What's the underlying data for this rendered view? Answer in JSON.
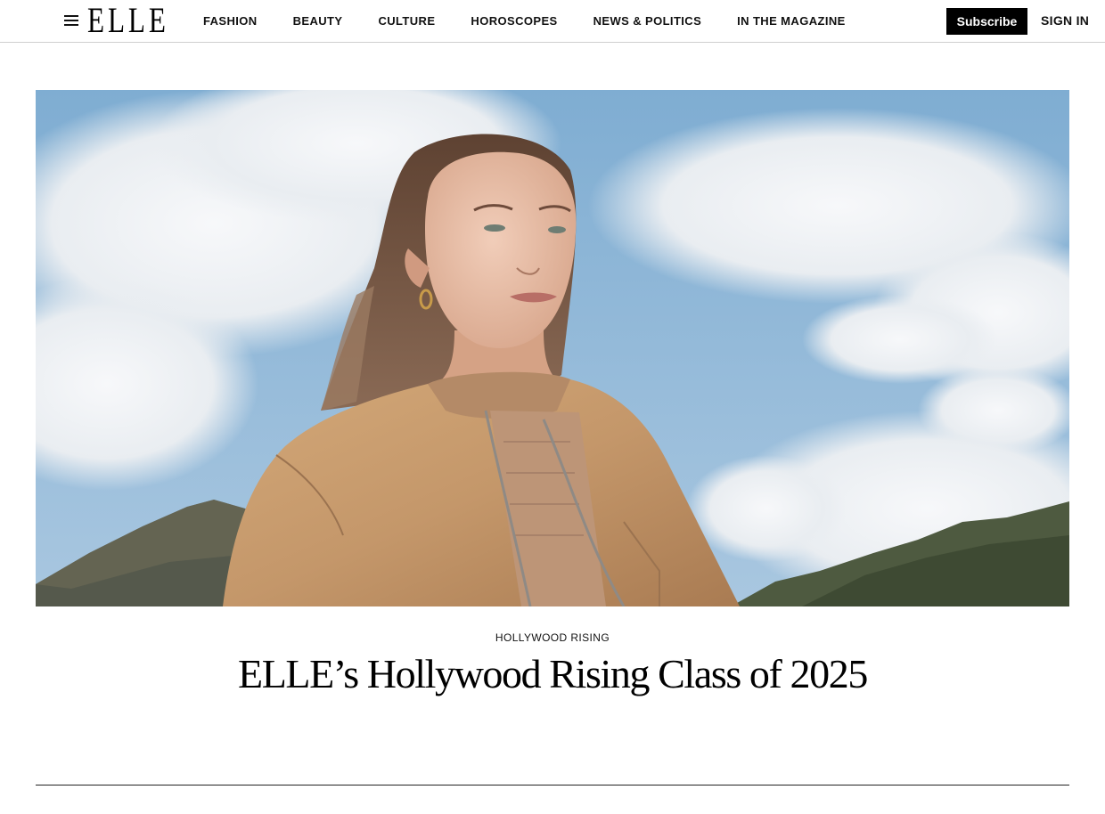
{
  "header": {
    "logo": "ELLE",
    "nav": [
      "FASHION",
      "BEAUTY",
      "CULTURE",
      "HOROSCOPES",
      "NEWS & POLITICS",
      "IN THE MAGAZINE"
    ],
    "subscribe_label": "Subscribe",
    "signin_label": "SIGN IN"
  },
  "icons": {
    "menu": "hamburger-menu-icon"
  },
  "article": {
    "kicker": "HOLLYWOOD RISING",
    "headline": "ELLE’s Hollywood Rising Class of 2025"
  },
  "colors": {
    "subscribe_bg": "#000000",
    "sky": "#8db6d6",
    "jacket": "#c69a69"
  }
}
